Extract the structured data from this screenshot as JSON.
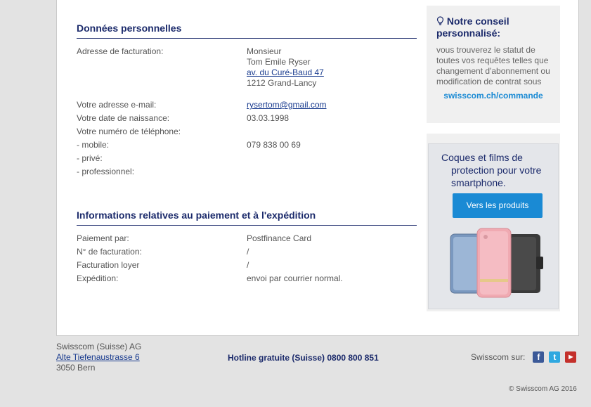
{
  "personal": {
    "heading": "Données personnelles",
    "billing_label": "Adresse de facturation:",
    "billing_salutation": "Monsieur",
    "billing_name": "Tom Emile Ryser",
    "billing_street": "av. du Curé-Baud 47",
    "billing_city": "1212 Grand-Lancy",
    "email_label": "Votre adresse e-mail:",
    "email_value": "rysertom@gmail.com",
    "dob_label": "Votre date de naissance:",
    "dob_value": "03.03.1998",
    "phone_label": "Votre numéro de téléphone:",
    "mobile_label": "- mobile:",
    "mobile_value": "079 838 00 69",
    "private_label": "- privé:",
    "pro_label": "- professionnel:"
  },
  "payment": {
    "heading": "Informations relatives au paiement et à l'expédition",
    "method_label": "Paiement par:",
    "method_value": "Postfinance Card",
    "billing_no_label": "N° de facturation:",
    "billing_no_value": "/",
    "rent_label": "Facturation loyer",
    "rent_value": "/",
    "shipping_label": "Expédition:",
    "shipping_value": "envoi par courrier normal."
  },
  "tip": {
    "icon": "lightbulb-icon",
    "title_line1": "Notre conseil",
    "title_line2": "personnalisé:",
    "text": "vous trouverez le statut de toutes vos requêtes telles que changement d'abonnement ou modification de contrat sous",
    "link": "swisscom.ch/commande"
  },
  "ad": {
    "line1": "Coques et films de",
    "line2": "protection pour votre",
    "line3": "smartphone.",
    "button": "Vers les produits"
  },
  "footer": {
    "company": "Swisscom (Suisse) AG",
    "street": "Alte Tiefenaustrasse 6",
    "city": "3050 Bern",
    "hotline": "Hotline gratuite (Suisse) 0800 800 851",
    "social_label": "Swisscom sur:",
    "copyright": "© Swisscom AG 2016",
    "colors": {
      "facebook": "#3b5998",
      "twitter": "#2fa8e0",
      "youtube": "#c4302b"
    }
  }
}
